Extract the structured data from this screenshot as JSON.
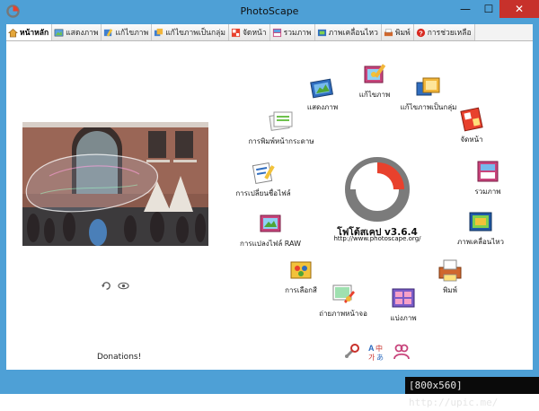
{
  "window": {
    "title": "PhotoScape",
    "minimize": "—",
    "maximize": "☐",
    "close": "✕"
  },
  "tabs": [
    {
      "label": "หน้าหลัก",
      "icon": "home-icon",
      "active": true
    },
    {
      "label": "แสดงภาพ",
      "icon": "viewer-icon",
      "active": false
    },
    {
      "label": "แก้ไขภาพ",
      "icon": "editor-icon",
      "active": false
    },
    {
      "label": "แก้ไขภาพเป็นกลุ่ม",
      "icon": "batch-editor-icon",
      "active": false
    },
    {
      "label": "จัดหน้า",
      "icon": "page-icon",
      "active": false
    },
    {
      "label": "รวมภาพ",
      "icon": "combine-icon",
      "active": false
    },
    {
      "label": "ภาพเคลื่อนไหว",
      "icon": "animated-gif-icon",
      "active": false
    },
    {
      "label": "พิมพ์",
      "icon": "print-icon",
      "active": false
    },
    {
      "label": "การช่วยเหลือ",
      "icon": "help-icon",
      "active": false
    }
  ],
  "features": {
    "viewer": "แสดงภาพ",
    "editor": "แก้ไขภาพ",
    "batch_editor": "แก้ไขภาพเป็นกลุ่ม",
    "page": "จัดหน้า",
    "combine": "รวมภาพ",
    "animated_gif": "ภาพเคลื่อนไหว",
    "print": "พิมพ์",
    "splitter": "แบ่งภาพ",
    "screen_capture": "ถ่ายภาพหน้าจอ",
    "color_picker": "การเลือกสี",
    "raw_converter": "การแปลงไฟล์ RAW",
    "rename": "การเปลี่ยนชื่อไฟล์",
    "paper_print": "การพิมพ์หน้ากระดาษ"
  },
  "logo": {
    "title": "โฟโต้สเคป v3.6.4",
    "url": "http://www.photoscape.org/"
  },
  "donations": "Donations!",
  "watermark": "[800x560] http://upic.me/",
  "colors": {
    "frame": "#4ea0d6",
    "close": "#c7312b",
    "logo_red": "#e8412d",
    "logo_gray": "#7b7b7b"
  }
}
